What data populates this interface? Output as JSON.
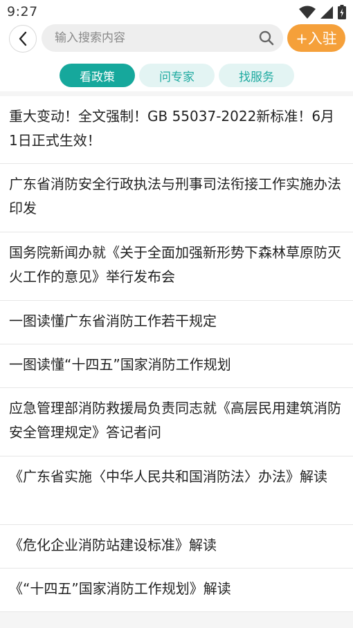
{
  "status_bar": {
    "time": "9:27",
    "icons": [
      "wifi-icon",
      "signal-icon",
      "battery-icon"
    ]
  },
  "header": {
    "search": {
      "placeholder": "输入搜索内容",
      "value": ""
    },
    "join_label": "+入驻"
  },
  "tabs": [
    {
      "label": "看政策",
      "active": true
    },
    {
      "label": "问专家",
      "active": false
    },
    {
      "label": "找服务",
      "active": false
    }
  ],
  "articles": [
    {
      "title": "重大变动！全文强制！GB 55037-2022新标准！6月1日正式生效！"
    },
    {
      "title": "广东省消防安全行政执法与刑事司法衔接工作实施办法印发"
    },
    {
      "title": "国务院新闻办就《关于全面加强新形势下森林草原防灭火工作的意见》举行发布会"
    },
    {
      "title": "一图读懂广东省消防工作若干规定"
    },
    {
      "title": "一图读懂“十四五”国家消防工作规划"
    },
    {
      "title": "应急管理部消防救援局负责同志就《高层民用建筑消防安全管理规定》答记者问"
    },
    {
      "title": "《广东省实施〈中华人民共和国消防法〉办法》解读"
    },
    {
      "title": "《危化企业消防站建设标准》解读"
    },
    {
      "title": "《“十四五”国家消防工作规划》解读"
    }
  ],
  "colors": {
    "accent": "#16a89c",
    "accent_light": "#e3f4f3",
    "join_button": "#f5a03a"
  }
}
